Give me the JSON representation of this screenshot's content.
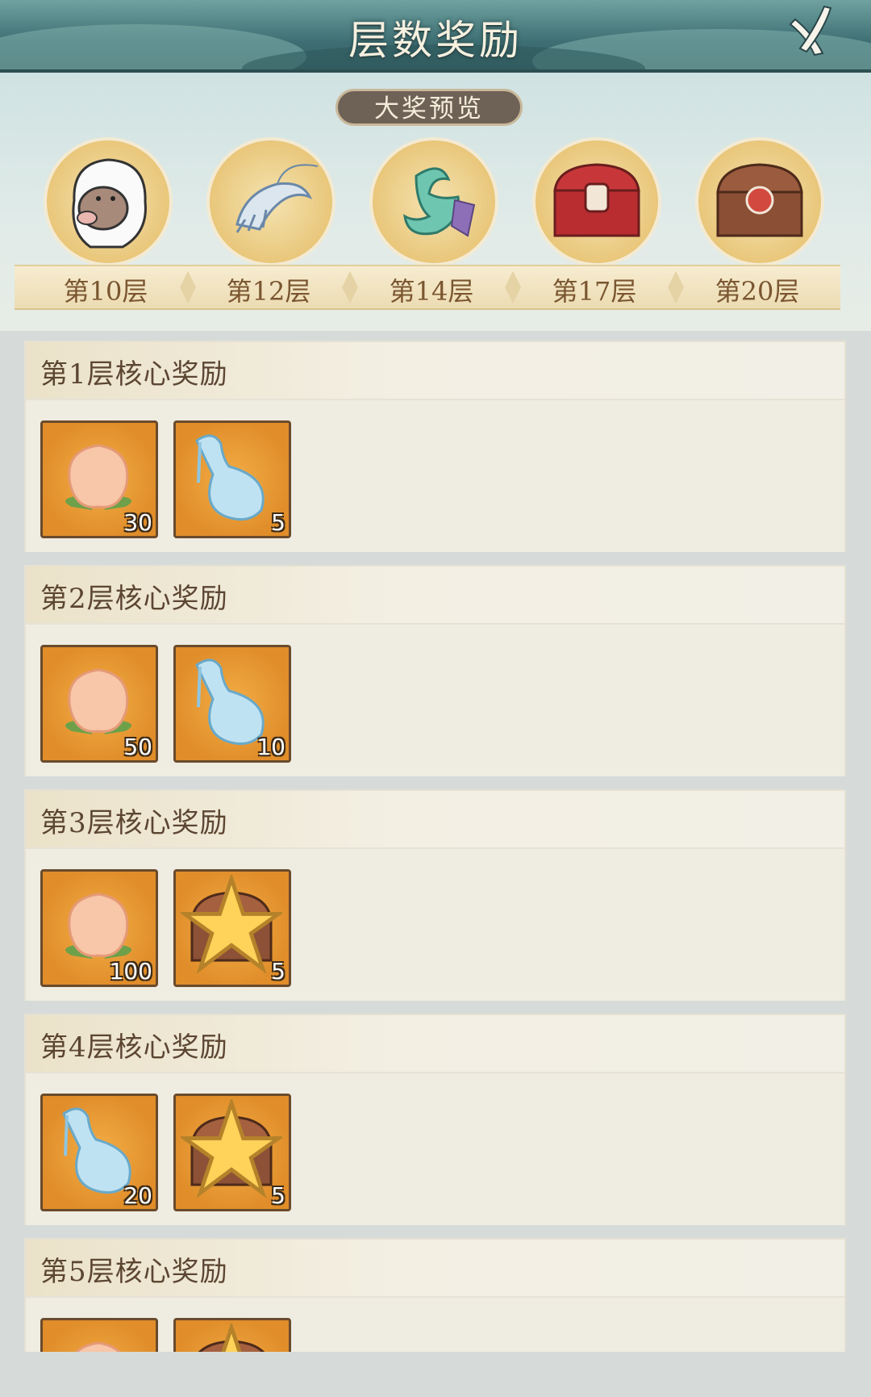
{
  "header": {
    "title": "层数奖励"
  },
  "preview": {
    "tag_label": "大奖预览",
    "prizes": [
      {
        "floor": "第10层",
        "icon": "boar-character-icon"
      },
      {
        "floor": "第12层",
        "icon": "shrimp-icon"
      },
      {
        "floor": "第14层",
        "icon": "jade-pendant-icon"
      },
      {
        "floor": "第17层",
        "icon": "red-treasure-chest-icon"
      },
      {
        "floor": "第20层",
        "icon": "bronze-treasure-chest-icon"
      }
    ]
  },
  "rewards": [
    {
      "title": "第1层核心奖励",
      "items": [
        {
          "icon": "peach-icon",
          "count": "30"
        },
        {
          "icon": "water-gourd-icon",
          "count": "5"
        }
      ]
    },
    {
      "title": "第2层核心奖励",
      "items": [
        {
          "icon": "peach-icon",
          "count": "50"
        },
        {
          "icon": "water-gourd-icon",
          "count": "10"
        }
      ]
    },
    {
      "title": "第3层核心奖励",
      "items": [
        {
          "icon": "peach-icon",
          "count": "100"
        },
        {
          "icon": "treasure-chest-icon",
          "count": "5"
        }
      ]
    },
    {
      "title": "第4层核心奖励",
      "items": [
        {
          "icon": "water-gourd-icon",
          "count": "20"
        },
        {
          "icon": "treasure-chest-icon",
          "count": "5"
        }
      ]
    },
    {
      "title": "第5层核心奖励",
      "items": [
        {
          "icon": "peach-icon",
          "count": ""
        },
        {
          "icon": "treasure-chest-icon",
          "count": ""
        }
      ]
    }
  ],
  "colors": {
    "accent": "#e08d2a",
    "header": "#3e6f74",
    "label": "#7a5630"
  }
}
